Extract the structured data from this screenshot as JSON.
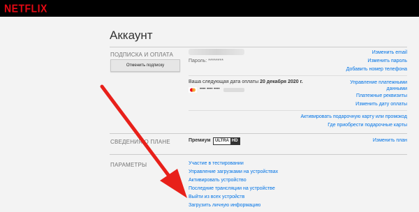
{
  "brand": {
    "logo": "NETFLIX",
    "color": "#e50914"
  },
  "page": {
    "title": "Аккаунт"
  },
  "membership": {
    "section_label": "ПОДПИСКА И ОПЛАТА",
    "cancel_button": "Отменить подписку",
    "password": "Пароль: ********",
    "links": [
      "Изменить email",
      "Изменить пароль",
      "Добавить номер телефона"
    ],
    "billing_text": "Ваша следующая дата оплаты",
    "billing_date": "20 декабря 2020 г.",
    "card_mask": "•••• •••• ••••",
    "billing_links": [
      "Управление платежными данными",
      "Платежные реквизиты",
      "Изменить дату оплаты"
    ],
    "gift_links": [
      "Активировать подарочную карту или промокод",
      "Где приобрести подарочные карты"
    ]
  },
  "plan": {
    "section_label": "СВЕДЕНИЯ О ПЛАНЕ",
    "plan_name": "Премиум",
    "badge_left": "ULTRA",
    "badge_right": "HD",
    "change_link": "Изменить план"
  },
  "settings": {
    "section_label": "ПАРАМЕТРЫ",
    "links": [
      "Участие в тестировании",
      "Управление загрузками на устройствах",
      "Активировать устройство",
      "Последние трансляции на устройстве",
      "Выйти из всех устройств",
      "Загрузить личную информацию"
    ]
  },
  "colors": {
    "link": "#0073e6",
    "annotation_arrow": "#e8201a",
    "background": "#f3f3f3"
  }
}
